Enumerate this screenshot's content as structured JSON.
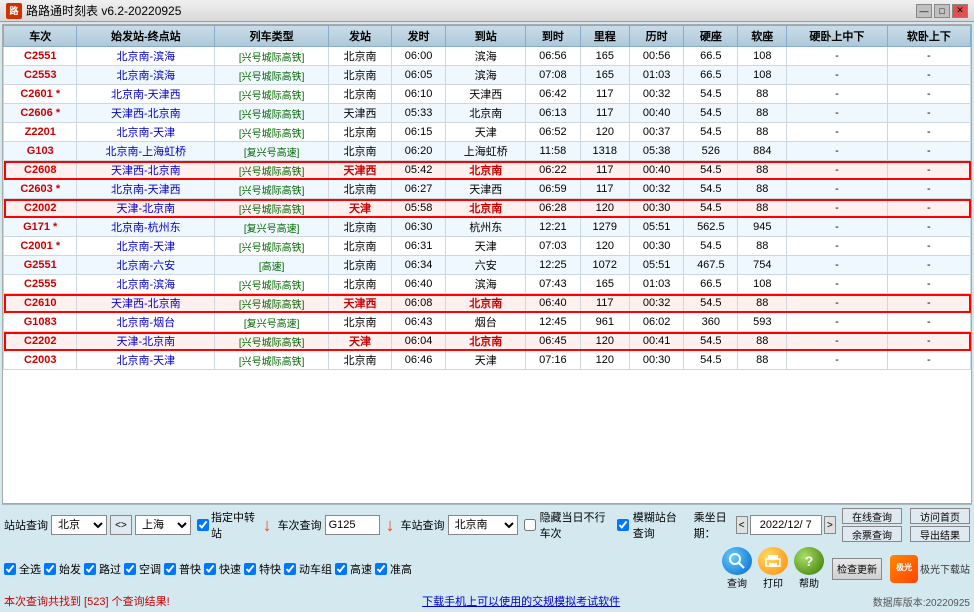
{
  "titleBar": {
    "icon": "🚌",
    "title": "路路通时刻表 v6.2-20220925",
    "minimizeBtn": "—",
    "maximizeBtn": "□",
    "closeBtn": "✕"
  },
  "table": {
    "headers": [
      "车次",
      "始发站-终点站",
      "列车类型",
      "发站",
      "发时",
      "到站",
      "到时",
      "里程",
      "历时",
      "硬座",
      "软座",
      "硬卧上中下",
      "软卧上下"
    ],
    "rows": [
      {
        "trainNo": "C2551",
        "route": "北京南-滨海",
        "trainType": "兴号城际高铁",
        "depart": "北京南",
        "departTime": "06:00",
        "arrive": "滨海",
        "arriveTime": "06:56",
        "distance": "165",
        "duration": "00:56",
        "hardSeat": "66.5",
        "softSeat": "108",
        "hardSleeper": "-",
        "softSleeper": "-",
        "highlight": false
      },
      {
        "trainNo": "C2553",
        "route": "北京南-滨海",
        "trainType": "兴号城际高铁",
        "depart": "北京南",
        "departTime": "06:05",
        "arrive": "滨海",
        "arriveTime": "07:08",
        "distance": "165",
        "duration": "01:03",
        "hardSeat": "66.5",
        "softSeat": "108",
        "hardSleeper": "-",
        "softSleeper": "-",
        "highlight": false
      },
      {
        "trainNo": "C2601 *",
        "route": "北京南-天津西",
        "trainType": "兴号城际高铁",
        "depart": "北京南",
        "departTime": "06:10",
        "arrive": "天津西",
        "arriveTime": "06:42",
        "distance": "117",
        "duration": "00:32",
        "hardSeat": "54.5",
        "softSeat": "88",
        "hardSleeper": "-",
        "softSleeper": "-",
        "highlight": false
      },
      {
        "trainNo": "C2606 *",
        "route": "天津西-北京南",
        "trainType": "兴号城际高铁",
        "depart": "天津西",
        "departTime": "05:33",
        "arrive": "北京南",
        "arriveTime": "06:13",
        "distance": "117",
        "duration": "00:40",
        "hardSeat": "54.5",
        "softSeat": "88",
        "hardSleeper": "-",
        "softSleeper": "-",
        "highlight": false
      },
      {
        "trainNo": "Z2201",
        "route": "北京南-天津",
        "trainType": "兴号城际高铁",
        "depart": "北京南",
        "departTime": "06:15",
        "arrive": "天津",
        "arriveTime": "06:52",
        "distance": "120",
        "duration": "00:37",
        "hardSeat": "54.5",
        "softSeat": "88",
        "hardSleeper": "-",
        "softSleeper": "-",
        "highlight": false
      },
      {
        "trainNo": "G103",
        "route": "北京南-上海虹桥",
        "trainType": "复兴号高速",
        "depart": "北京南",
        "departTime": "06:20",
        "arrive": "上海虹桥",
        "arriveTime": "11:58",
        "distance": "1318",
        "duration": "05:38",
        "hardSeat": "526",
        "softSeat": "884",
        "hardSleeper": "-",
        "softSleeper": "-",
        "highlight": false
      },
      {
        "trainNo": "C2608",
        "route": "天津西-北京南",
        "trainType": "兴号城际高铁",
        "depart": "天津西",
        "departTime": "05:42",
        "arrive": "北京南",
        "arriveTime": "06:22",
        "distance": "117",
        "duration": "00:40",
        "hardSeat": "54.5",
        "softSeat": "88",
        "hardSleeper": "-",
        "softSleeper": "-",
        "highlight": true
      },
      {
        "trainNo": "C2603 *",
        "route": "北京南-天津西",
        "trainType": "兴号城际高铁",
        "depart": "北京南",
        "departTime": "06:27",
        "arrive": "天津西",
        "arriveTime": "06:59",
        "distance": "117",
        "duration": "00:32",
        "hardSeat": "54.5",
        "softSeat": "88",
        "hardSleeper": "-",
        "softSleeper": "-",
        "highlight": false
      },
      {
        "trainNo": "C2002",
        "route": "天津-北京南",
        "trainType": "兴号城际高铁",
        "depart": "天津",
        "departTime": "05:58",
        "arrive": "北京南",
        "arriveTime": "06:28",
        "distance": "120",
        "duration": "00:30",
        "hardSeat": "54.5",
        "softSeat": "88",
        "hardSleeper": "-",
        "softSleeper": "-",
        "highlight": true
      },
      {
        "trainNo": "G171 *",
        "route": "北京南-杭州东",
        "trainType": "复兴号高速",
        "depart": "北京南",
        "departTime": "06:30",
        "arrive": "杭州东",
        "arriveTime": "12:21",
        "distance": "1279",
        "duration": "05:51",
        "hardSeat": "562.5",
        "softSeat": "945",
        "hardSleeper": "-",
        "softSleeper": "-",
        "highlight": false
      },
      {
        "trainNo": "C2001 *",
        "route": "北京南-天津",
        "trainType": "兴号城际高铁",
        "depart": "北京南",
        "departTime": "06:31",
        "arrive": "天津",
        "arriveTime": "07:03",
        "distance": "120",
        "duration": "00:30",
        "hardSeat": "54.5",
        "softSeat": "88",
        "hardSleeper": "-",
        "softSleeper": "-",
        "highlight": false
      },
      {
        "trainNo": "G2551",
        "route": "北京南-六安",
        "trainType": "高速",
        "depart": "北京南",
        "departTime": "06:34",
        "arrive": "六安",
        "arriveTime": "12:25",
        "distance": "1072",
        "duration": "05:51",
        "hardSeat": "467.5",
        "softSeat": "754",
        "hardSleeper": "-",
        "softSleeper": "-",
        "highlight": false
      },
      {
        "trainNo": "C2555",
        "route": "北京南-滨海",
        "trainType": "兴号城际高铁",
        "depart": "北京南",
        "departTime": "06:40",
        "arrive": "滨海",
        "arriveTime": "07:43",
        "distance": "165",
        "duration": "01:03",
        "hardSeat": "66.5",
        "softSeat": "108",
        "hardSleeper": "-",
        "softSleeper": "-",
        "highlight": false
      },
      {
        "trainNo": "C2610",
        "route": "天津西-北京南",
        "trainType": "兴号城际高铁",
        "depart": "天津西",
        "departTime": "06:08",
        "arrive": "北京南",
        "arriveTime": "06:40",
        "distance": "117",
        "duration": "00:32",
        "hardSeat": "54.5",
        "softSeat": "88",
        "hardSleeper": "-",
        "softSleeper": "-",
        "highlight": true
      },
      {
        "trainNo": "G1083",
        "route": "北京南-烟台",
        "trainType": "复兴号高速",
        "depart": "北京南",
        "departTime": "06:43",
        "arrive": "烟台",
        "arriveTime": "12:45",
        "distance": "961",
        "duration": "06:02",
        "hardSeat": "360",
        "softSeat": "593",
        "hardSleeper": "-",
        "softSleeper": "-",
        "highlight": false
      },
      {
        "trainNo": "C2202",
        "route": "天津-北京南",
        "trainType": "兴号城际高铁",
        "depart": "天津",
        "departTime": "06:04",
        "arrive": "北京南",
        "arriveTime": "06:45",
        "distance": "120",
        "duration": "00:41",
        "hardSeat": "54.5",
        "softSeat": "88",
        "hardSleeper": "-",
        "softSleeper": "-",
        "highlight": true
      },
      {
        "trainNo": "C2003",
        "route": "北京南-天津",
        "trainType": "兴号城际高铁",
        "depart": "北京南",
        "departTime": "06:46",
        "arrive": "天津",
        "arriveTime": "07:16",
        "distance": "120",
        "duration": "00:30",
        "hardSeat": "54.5",
        "softSeat": "88",
        "hardSleeper": "-",
        "softSleeper": "-",
        "highlight": false
      }
    ]
  },
  "controls": {
    "stationQuery": {
      "label": "站站查询",
      "fromStation": "北京",
      "swapBtn": "<>",
      "toStation": "上海"
    },
    "transferCheckbox": {
      "label": "指定中转站",
      "checked": true
    },
    "trainQuery": {
      "label": "车次查询",
      "value": "G125"
    },
    "stationQueryLabel": "车站查询",
    "arrivalStation": "北京南",
    "hideCheckbox": {
      "label": "隐藏当日不行车次",
      "checked": false
    },
    "fuzzyCheckbox": {
      "label": "模糊站台查询",
      "checked": true
    },
    "boardingDate": {
      "label": "乘坐日期：",
      "value": "2022/12/ 7",
      "prevBtn": "<",
      "nextBtn": ">"
    },
    "onlineQueryBtn": "在线查询",
    "remainTicketBtn": "余票查询",
    "checkboxes": [
      {
        "id": "allSelect",
        "label": "全选",
        "checked": true
      },
      {
        "id": "startStation",
        "label": "始发",
        "checked": true
      },
      {
        "id": "passing",
        "label": "路过",
        "checked": true
      },
      {
        "id": "aircon",
        "label": "空调",
        "checked": true
      },
      {
        "id": "express",
        "label": "普快",
        "checked": true
      },
      {
        "id": "fastExpress",
        "label": "快速",
        "checked": true
      },
      {
        "id": "special",
        "label": "特快",
        "checked": true
      },
      {
        "id": "emu",
        "label": "动车组",
        "checked": true
      },
      {
        "id": "highSpeed",
        "label": "高速",
        "checked": true
      },
      {
        "id": "zhunGao",
        "label": "准高",
        "checked": true
      }
    ],
    "queryBtn": "查询",
    "printBtn": "打印",
    "helpBtn": "帮助",
    "visitHomeBtn": "访问首页",
    "exportBtn": "导出结果",
    "checkUpdateBtn": "检查更新",
    "statusText": "本次查询共找到 [523] 个查询结果!",
    "downloadLink": "下载手机上可以使用的交规模拟考试软件",
    "versionText": "数据库版本:20220925"
  },
  "logoText": "极光下载站"
}
